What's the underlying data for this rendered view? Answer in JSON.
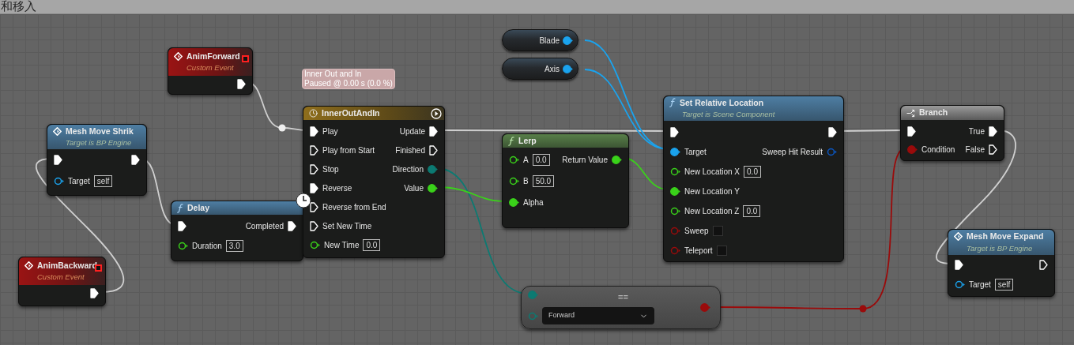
{
  "editor": {
    "title": "和移入"
  },
  "nodes": [
    {
      "kind": "event",
      "title": "AnimForward",
      "subtitle": "Custom Event",
      "outputs": [
        {
          "kind": "exec",
          "connected": true
        }
      ]
    },
    {
      "kind": "function",
      "title": "Mesh Move Shrik",
      "subtitle": "Target is BP Engine",
      "inputs": [
        {
          "kind": "exec",
          "connected": true
        },
        {
          "kind": "object",
          "label": "Target",
          "connected": false,
          "value": "self"
        }
      ],
      "outputs": [
        {
          "kind": "exec",
          "connected": true
        }
      ]
    },
    {
      "kind": "event",
      "title": "AnimBackward",
      "subtitle": "Custom Event",
      "outputs": [
        {
          "kind": "exec",
          "connected": true
        }
      ]
    },
    {
      "kind": "function",
      "title": "Delay",
      "latent": true,
      "inputs": [
        {
          "kind": "exec",
          "connected": true
        },
        {
          "kind": "float",
          "label": "Duration",
          "connected": false,
          "value": "3.0"
        }
      ],
      "outputs": [
        {
          "kind": "exec",
          "label": "Completed",
          "connected": true
        }
      ]
    },
    {
      "kind": "timeline",
      "title": "InnerOutAndIn",
      "bubble": [
        "Inner Out and In",
        "Paused @ 0.00 s (0.0 %)"
      ],
      "inputs": [
        {
          "kind": "exec",
          "label": "Play",
          "connected": true
        },
        {
          "kind": "exec",
          "label": "Play from Start",
          "connected": false
        },
        {
          "kind": "exec",
          "label": "Stop",
          "connected": false
        },
        {
          "kind": "exec",
          "label": "Reverse",
          "connected": true
        },
        {
          "kind": "exec",
          "label": "Reverse from End",
          "connected": false
        },
        {
          "kind": "exec",
          "label": "Set New Time",
          "connected": false
        },
        {
          "kind": "float",
          "label": "New Time",
          "connected": false,
          "value": "0.0"
        }
      ],
      "outputs": [
        {
          "kind": "exec",
          "label": "Update",
          "connected": true
        },
        {
          "kind": "exec",
          "label": "Finished",
          "connected": false
        },
        {
          "kind": "byte",
          "label": "Direction",
          "connected": true
        },
        {
          "kind": "float",
          "label": "Value",
          "connected": true
        }
      ]
    },
    {
      "kind": "variable",
      "title": "Blade",
      "outputs": [
        {
          "kind": "object",
          "connected": true
        }
      ]
    },
    {
      "kind": "variable",
      "title": "Axis",
      "outputs": [
        {
          "kind": "object",
          "connected": true
        }
      ]
    },
    {
      "kind": "pure",
      "title": "Lerp",
      "inputs": [
        {
          "kind": "float",
          "label": "A",
          "connected": false,
          "value": "0.0"
        },
        {
          "kind": "float",
          "label": "B",
          "connected": false,
          "value": "50.0"
        },
        {
          "kind": "float",
          "label": "Alpha",
          "connected": true
        }
      ],
      "outputs": [
        {
          "kind": "float",
          "label": "Return Value",
          "connected": true
        }
      ]
    },
    {
      "kind": "function",
      "title": "Set Relative Location",
      "subtitle": "Target is Scene Component",
      "inputs": [
        {
          "kind": "exec",
          "connected": true
        },
        {
          "kind": "object",
          "label": "Target",
          "connected": true
        },
        {
          "kind": "float",
          "label": "New Location X",
          "connected": false,
          "value": "0.0"
        },
        {
          "kind": "float",
          "label": "New Location Y",
          "connected": true
        },
        {
          "kind": "float",
          "label": "New Location Z",
          "connected": false,
          "value": "0.0"
        },
        {
          "kind": "bool",
          "label": "Sweep",
          "connected": false,
          "checked": false
        },
        {
          "kind": "bool",
          "label": "Teleport",
          "connected": false,
          "checked": false
        }
      ],
      "outputs": [
        {
          "kind": "exec",
          "connected": true
        },
        {
          "kind": "struct",
          "label": "Sweep Hit Result",
          "connected": false
        }
      ]
    },
    {
      "kind": "branch",
      "title": "Branch",
      "inputs": [
        {
          "kind": "exec",
          "connected": true
        },
        {
          "kind": "bool",
          "label": "Condition",
          "connected": true
        }
      ],
      "outputs": [
        {
          "kind": "exec",
          "label": "True",
          "connected": true
        },
        {
          "kind": "exec",
          "label": "False",
          "connected": false
        }
      ]
    },
    {
      "kind": "function",
      "title": "Mesh Move Expand",
      "subtitle": "Target is BP Engine",
      "inputs": [
        {
          "kind": "exec",
          "connected": true
        },
        {
          "kind": "object",
          "label": "Target",
          "connected": false,
          "value": "self"
        }
      ],
      "outputs": [
        {
          "kind": "exec",
          "connected": false
        }
      ]
    },
    {
      "kind": "compare",
      "title": "==",
      "inputs": [
        {
          "kind": "byte",
          "connected": true
        },
        {
          "kind": "byte",
          "connected": false,
          "value": "Forward"
        }
      ],
      "outputs": [
        {
          "kind": "bool",
          "connected": true
        }
      ]
    }
  ]
}
